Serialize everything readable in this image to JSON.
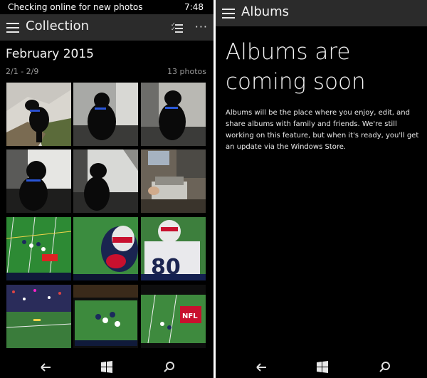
{
  "left": {
    "status": {
      "text": "Checking online for new photos",
      "time": "7:48"
    },
    "titlebar": {
      "title": "Collection",
      "menu_icon": "hamburger-icon",
      "select_icon": "multi-select-icon",
      "more_icon": "more-icon",
      "more_glyph": "···"
    },
    "section": {
      "month": "February 2015",
      "range": "2/1 - 2/9",
      "count": "13 photos"
    },
    "photos": [
      {
        "subject": "black dog sitting on snowy hillside"
      },
      {
        "subject": "black dog in car seat"
      },
      {
        "subject": "black dog in car seat"
      },
      {
        "subject": "black dog looking out car window"
      },
      {
        "subject": "black dog in car by window"
      },
      {
        "subject": "office desk with printer"
      },
      {
        "subject": "football game on TV, wide shot"
      },
      {
        "subject": "Patriots player closeup on TV"
      },
      {
        "subject": "Patriots player number 80 on TV"
      },
      {
        "subject": "stadium crowd on TV"
      },
      {
        "subject": "football players huddle on TV"
      },
      {
        "subject": "football field with NFL logo on TV"
      }
    ],
    "nav": {
      "back_icon": "back-arrow-icon",
      "start_icon": "windows-start-icon",
      "search_icon": "search-icon"
    }
  },
  "right": {
    "titlebar": {
      "title": "Albums",
      "menu_icon": "hamburger-icon"
    },
    "headline_lines": [
      "Albums are",
      "coming soon"
    ],
    "body_lines": [
      "Albums will be the place where you enjoy, edit, and",
      "share albums with family and friends. We're still",
      "working on this feature, but when it's ready, you'll get",
      "an update via the Windows Store."
    ],
    "nav": {
      "back_icon": "back-arrow-icon",
      "start_icon": "windows-start-icon",
      "search_icon": "search-icon"
    }
  }
}
